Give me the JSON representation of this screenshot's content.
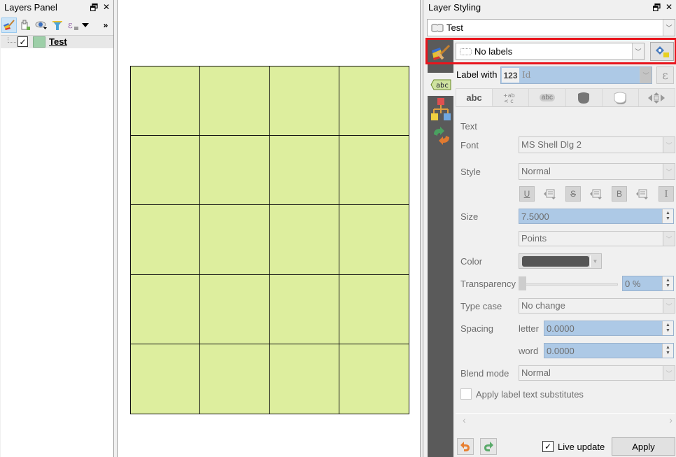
{
  "layers_panel": {
    "title": "Layers Panel",
    "toolbar": [
      "style-manager-icon",
      "add-group-icon",
      "visibility-icon",
      "filter-icon",
      "expression-filter-icon",
      "dropdown-icon",
      "more-icon"
    ],
    "more_label": "»",
    "layers": [
      {
        "name": "Test",
        "checked": true,
        "swatch_color": "#9dcfa8"
      }
    ]
  },
  "map": {
    "grid": {
      "rows": 5,
      "cols": 4,
      "fill_color": "#ddee9e",
      "stroke_color": "#111111"
    }
  },
  "styling": {
    "title": "Layer Styling",
    "layer_selector": {
      "value": "Test"
    },
    "renderer": {
      "value": "No labels"
    },
    "label_with": {
      "label": "Label with",
      "field_type": "123",
      "field": "Id"
    },
    "tabs": [
      {
        "name": "text",
        "label": "abc"
      },
      {
        "name": "formatting",
        "label": "+ab < c"
      },
      {
        "name": "buffer",
        "label": "abc"
      },
      {
        "name": "background",
        "label": ""
      },
      {
        "name": "shadow",
        "label": ""
      },
      {
        "name": "placement",
        "label": ""
      }
    ],
    "section": "Text",
    "font": {
      "label": "Font",
      "value": "MS Shell Dlg 2"
    },
    "style": {
      "label": "Style",
      "value": "Normal"
    },
    "format_buttons": {
      "underline": "U",
      "strikeout": "S",
      "bold": "B",
      "italic": "I"
    },
    "size": {
      "label": "Size",
      "value": "7.5000",
      "unit": "Points"
    },
    "color": {
      "label": "Color",
      "value": "#555555"
    },
    "transparency": {
      "label": "Transparency",
      "value": "0 %",
      "percent": 0
    },
    "type_case": {
      "label": "Type case",
      "value": "No change"
    },
    "spacing": {
      "label": "Spacing",
      "letter_label": "letter",
      "letter_value": "0.0000",
      "word_label": "word",
      "word_value": "0.0000"
    },
    "blend_mode": {
      "label": "Blend mode",
      "value": "Normal"
    },
    "substitutes": {
      "label": "Apply label text substitutes",
      "checked": false
    },
    "live_update": {
      "label": "Live update",
      "checked": true
    },
    "apply_label": "Apply",
    "highlight_color": "#e8141c"
  }
}
